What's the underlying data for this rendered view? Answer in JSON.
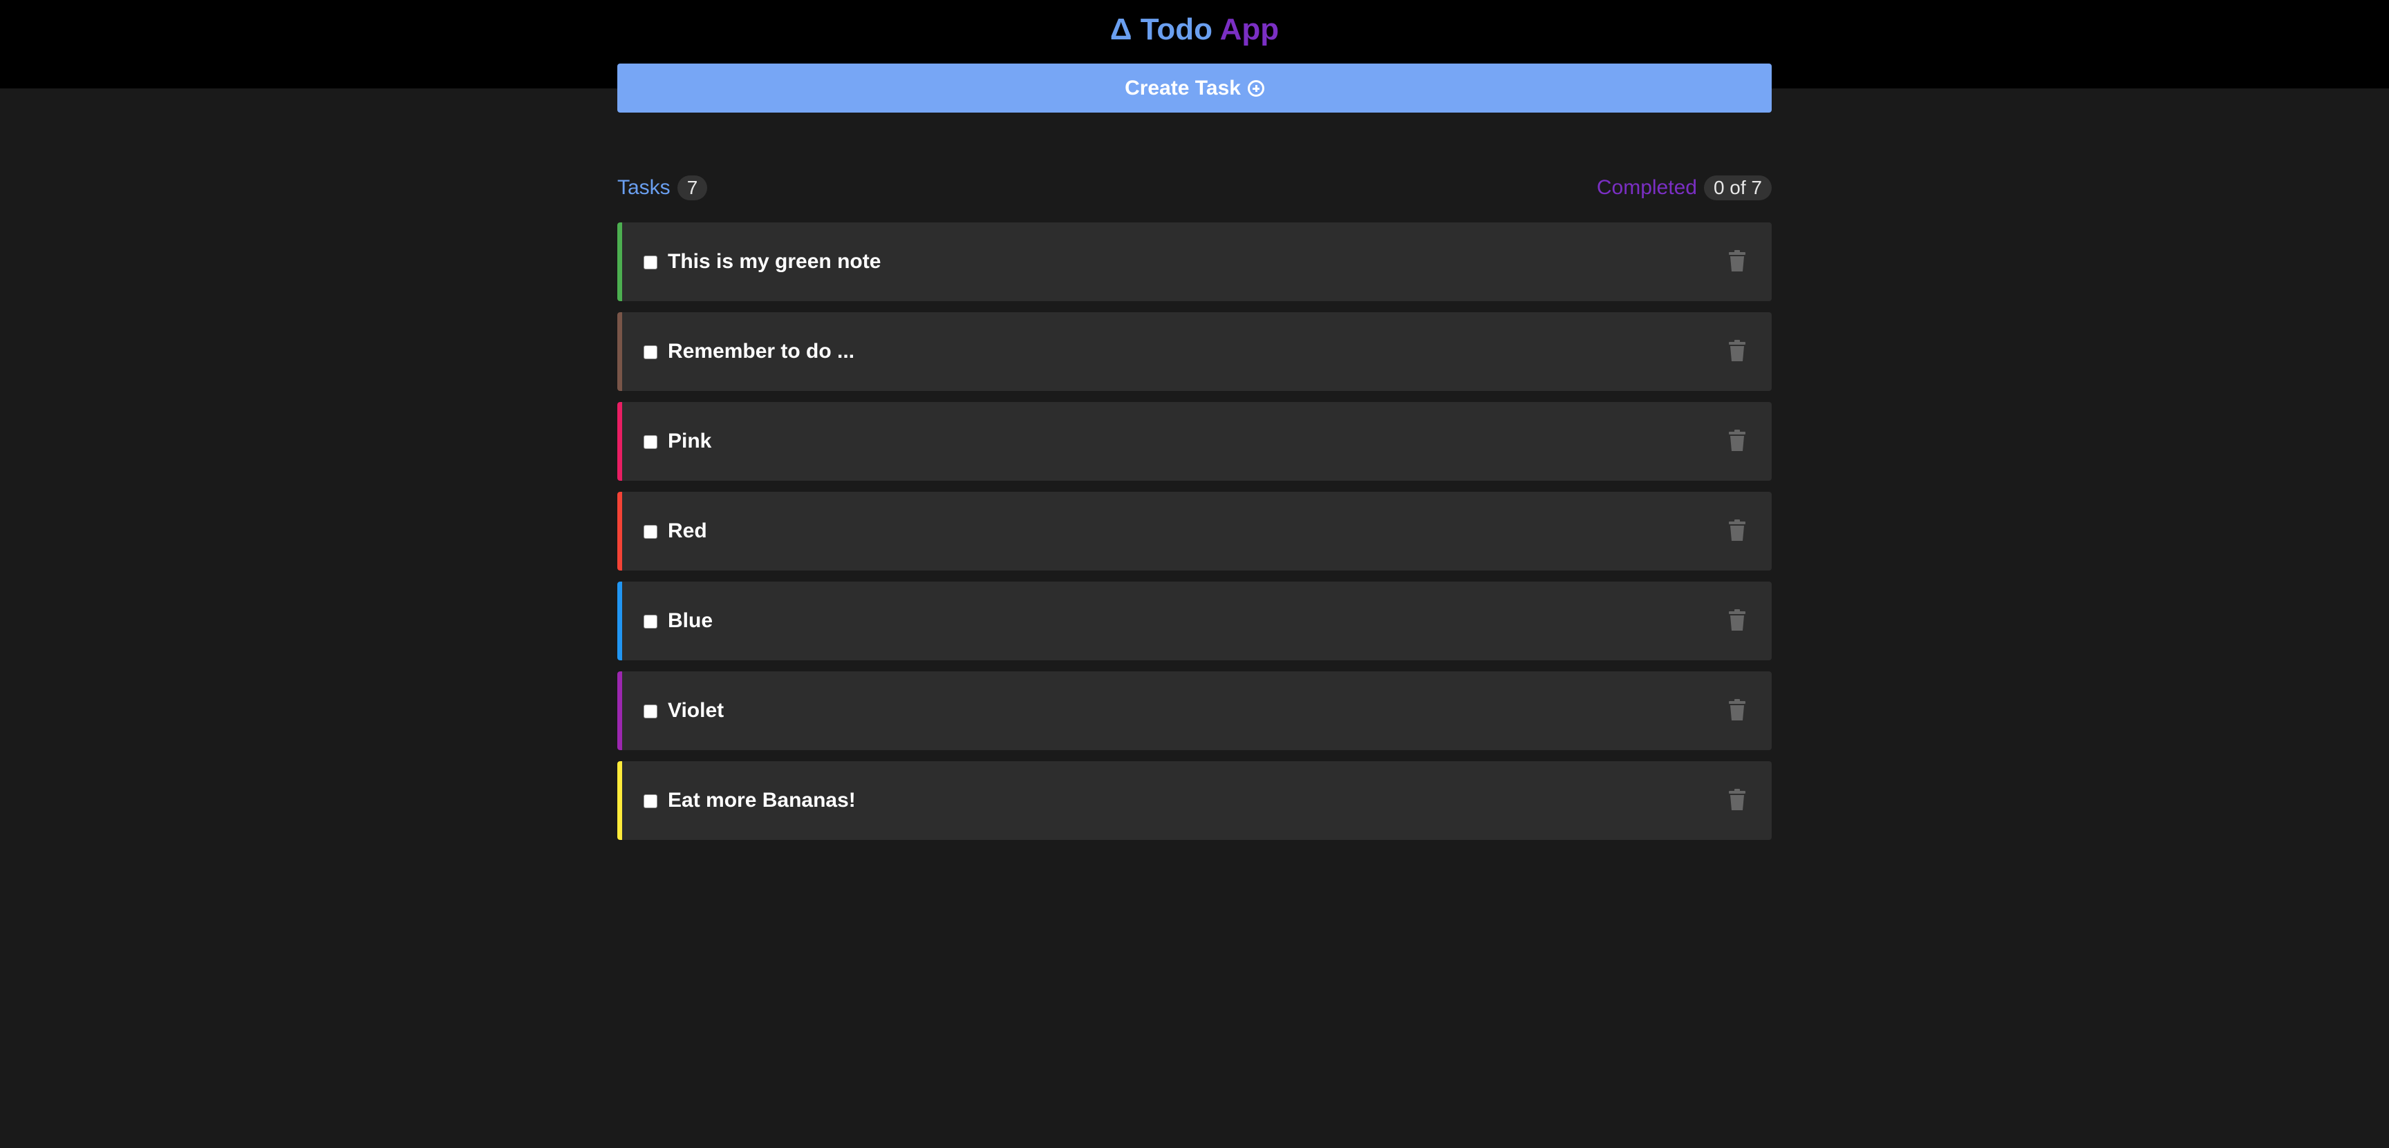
{
  "header": {
    "title_prefix": "Δ Todo",
    "title_suffix": "App",
    "create_button_label": "Create Task"
  },
  "stats": {
    "tasks_label": "Tasks",
    "tasks_count": "7",
    "completed_label": "Completed",
    "completed_count": "0 of 7"
  },
  "tasks": [
    {
      "text": "This is my green note",
      "color": "#4caf50",
      "checked": false
    },
    {
      "text": "Remember to do ...",
      "color": "#795548",
      "checked": false
    },
    {
      "text": "Pink",
      "color": "#e91e63",
      "checked": false
    },
    {
      "text": "Red",
      "color": "#f44336",
      "checked": false
    },
    {
      "text": "Blue",
      "color": "#2196f3",
      "checked": false
    },
    {
      "text": "Violet",
      "color": "#9c27b0",
      "checked": false
    },
    {
      "text": "Eat more Bananas!",
      "color": "#ffeb3b",
      "checked": false
    }
  ],
  "icons": {
    "create": "plus-circle-icon",
    "delete": "trash-icon"
  },
  "colors": {
    "topbar": "#000000",
    "background": "#1a1a1a",
    "card": "#2d2d2d",
    "accent_blue": "#6a9ff0",
    "accent_purple": "#7b2fc4",
    "button": "#77a6f5"
  }
}
